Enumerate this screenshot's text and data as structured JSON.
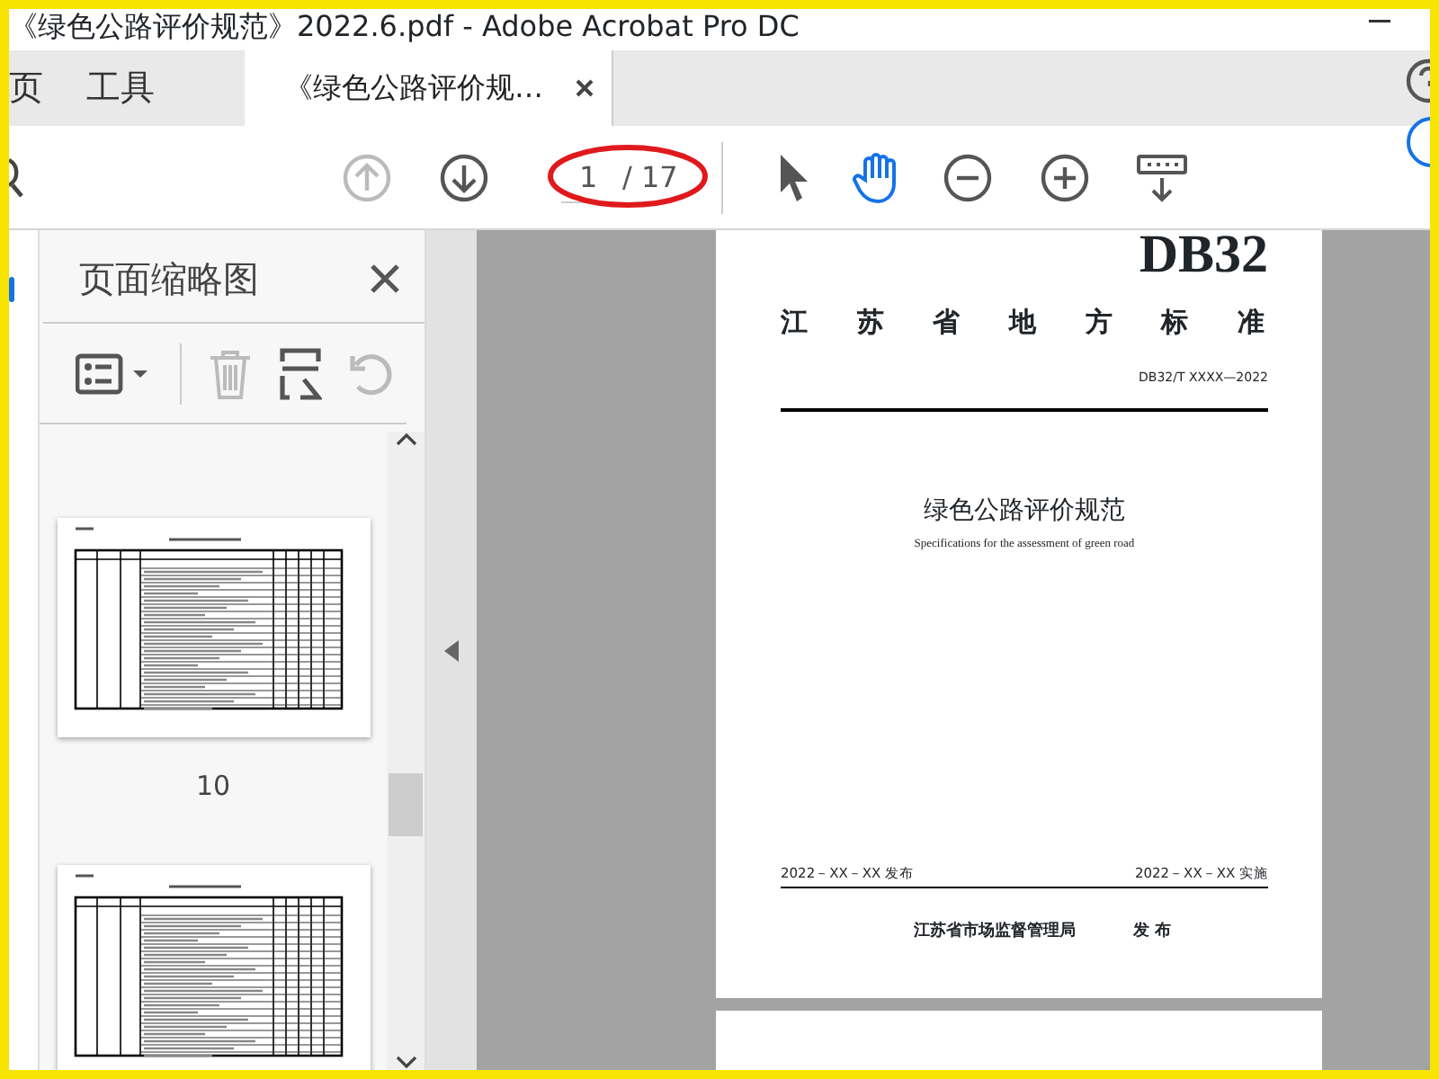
{
  "window": {
    "title": "《绿色公路评价规范》2022.6.pdf - Adobe Acrobat Pro DC"
  },
  "nav_tabs": [
    {
      "label": "页",
      "kind": "home",
      "selected": false
    },
    {
      "label": "工具",
      "kind": "tools",
      "selected": false
    },
    {
      "label": "《绿色公路评价规…",
      "kind": "document",
      "selected": true
    }
  ],
  "toolbar": {
    "page_buttons": [
      {
        "kind": "page-up",
        "disabled": true
      },
      {
        "kind": "page-down",
        "disabled": false
      }
    ],
    "page_field": {
      "value": "1"
    },
    "page_total": "/ 17",
    "modes": [
      {
        "kind": "pointer",
        "selected": false
      },
      {
        "kind": "hand",
        "selected": true
      }
    ],
    "zoom_buttons": [
      {
        "kind": "zoom-out"
      },
      {
        "kind": "zoom-in"
      },
      {
        "kind": "more-tools"
      }
    ]
  },
  "sidebar": {
    "title": "页面缩略图",
    "tools": [
      {
        "kind": "options",
        "disabled": false
      },
      {
        "kind": "delete",
        "disabled": true
      },
      {
        "kind": "extract",
        "disabled": false
      },
      {
        "kind": "rotate",
        "disabled": true
      }
    ],
    "thumbnails": [
      {
        "kind": "page",
        "label": "10"
      },
      {
        "kind": "page"
      }
    ]
  },
  "document": {
    "code": "DB32",
    "authority": "江苏省地方标准",
    "number": "DB32/T XXXX—2022",
    "title": "绿色公路评价规范",
    "subtitle": "Specifications for the assessment of green road",
    "issue_date": "2022－XX－XX 发布",
    "effective_date": "2022－XX－XX 实施",
    "issuer": "江苏省市场监督管理局",
    "issued": "发 布"
  }
}
